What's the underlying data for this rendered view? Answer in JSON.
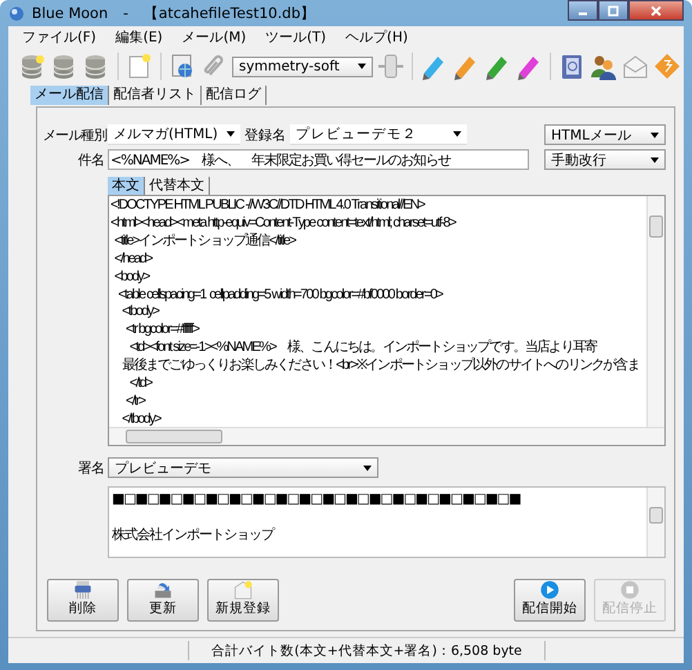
{
  "window": {
    "title": "Blue Moon　-　【atcahefileTest10.db】"
  },
  "menu": [
    "ファイル(F)",
    "編集(E)",
    "メール(M)",
    "ツール(T)",
    "ヘルプ(H)"
  ],
  "toolbar": {
    "account": "symmetry-soft"
  },
  "tabs": [
    {
      "label": "メール配信",
      "selected": true
    },
    {
      "label": "配信者リスト",
      "selected": false
    },
    {
      "label": "配信ログ",
      "selected": false
    }
  ],
  "form": {
    "mail_type": {
      "label": "メール種別",
      "value": "メルマガ(HTML)"
    },
    "registered_name": {
      "label": "登録名",
      "value": "プレビューデモ２"
    },
    "format": "HTMLメール",
    "subject": {
      "label": "件名",
      "value": "<%NAME%>　様へ、　年末限定お買い得セールのお知らせ"
    },
    "line_break": "手動改行"
  },
  "body_tabs": [
    {
      "label": "本文",
      "selected": true
    },
    {
      "label": "代替本文",
      "selected": false
    }
  ],
  "body_lines": [
    "<!DOCTYPE HTML PUBLIC -//W3C//DTD HTML 4.0 Transitional//EN>",
    "<html><head><meta http-equiv=Content-Type content=text/html; charset=utf-8>",
    "  <title>インポートショップ通信</title>",
    "  </head>",
    "  <body>",
    "    <table cellspacing=1  cellpadding=5 width=700 bgcolor=#bf0000 border=0>",
    "      <tbody>",
    "        <tr bgcolor=#ffffff>",
    "          <td><font size=-1><%NAME%>　様、こんにちは。インポートショップです。当店より耳寄",
    "      最後までごゆっくりお楽しみください！<br>※インポートショップ以外のサイトへのリンクが含ま",
    "          </td>",
    "        </tr>",
    "      </tbody>"
  ],
  "signature": {
    "label": "署名",
    "value": "プレビューデモ",
    "lines": [
      "■□■□■□■□■□■□■□■□■□■□■□■□■□■□■□■□■□■",
      "株式会社インポートショップ"
    ]
  },
  "buttons": [
    {
      "label": "削除",
      "kind": "delete",
      "disabled": false
    },
    {
      "label": "更新",
      "kind": "update",
      "disabled": false
    },
    {
      "label": "新規登録",
      "kind": "new",
      "disabled": false
    },
    {
      "label": "配信開始",
      "kind": "start",
      "disabled": false
    },
    {
      "label": "配信停止",
      "kind": "stop",
      "disabled": true
    }
  ],
  "status_bar": "合計バイト数(本文+代替本文+署名)：6,508 byte"
}
